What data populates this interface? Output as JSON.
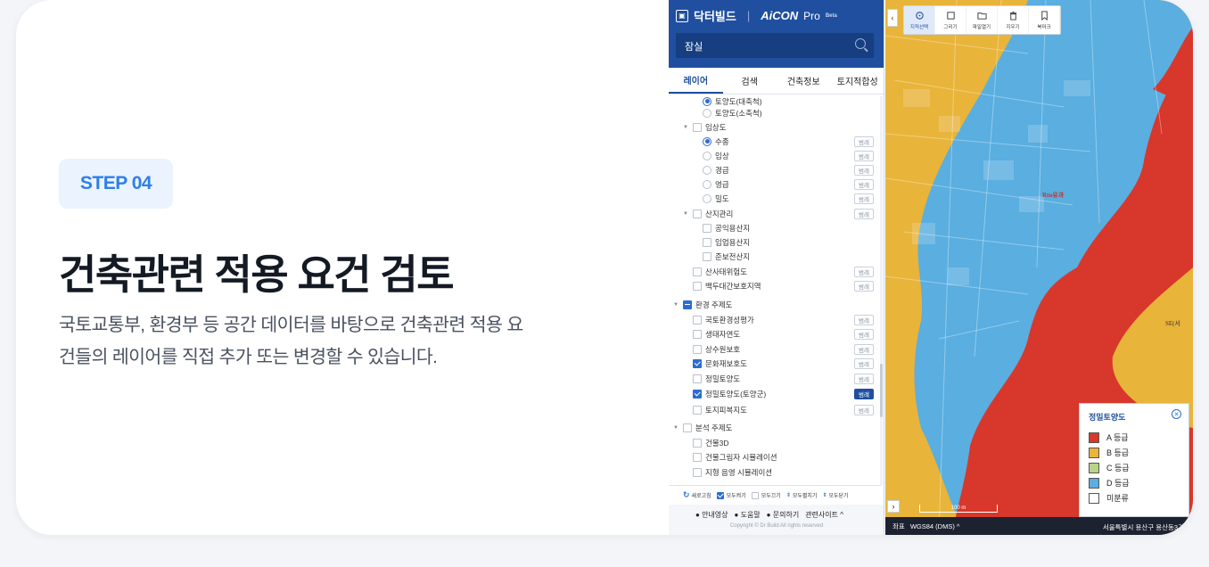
{
  "intro": {
    "step": "STEP 04",
    "headline": "건축관련 적용 요건 검토",
    "desc_line1": "국토교통부, 환경부 등 공간 데이터를 바탕으로 건축관련 적용 요",
    "desc_line2": "건들의 레이어를 직접 추가 또는 변경할 수 있습니다."
  },
  "app": {
    "brand": "닥터빌드",
    "brand2": "AiCON",
    "brand3": "Pro",
    "brand_beta": "Beta",
    "search_value": "잠실",
    "tabs": [
      "레이어",
      "검색",
      "건축정보",
      "토지적합성"
    ],
    "legend_label": "범례",
    "layers": [
      "토양도(대축척)",
      "토양도(소축척)",
      "임상도",
      "수종",
      "임상",
      "경급",
      "영급",
      "밀도",
      "산지관리",
      "공익용산지",
      "임업용산지",
      "준보전산지",
      "산사태위험도",
      "백두대간보호지역",
      "환경 주제도",
      "국토환경성평가",
      "생태자연도",
      "상수원보호",
      "문화재보호도",
      "정밀토양도",
      "정밀토양도(토양군)",
      "토지피복지도",
      "분석 주제도",
      "건물3D",
      "건물그림자 시뮬레이션",
      "지형 음영 시뮬레이션"
    ],
    "actions": [
      "새로고침",
      "모두켜기",
      "모두끄기",
      "모두펼치기",
      "모두닫기"
    ],
    "footer": [
      "안내영상",
      "도움말",
      "문의하기",
      "관련사이트 ^"
    ],
    "copyright": "Copyright © Dr Build All rights reserved"
  },
  "map": {
    "tools": [
      "지적선택",
      "그리기",
      "파일열기",
      "지우기",
      "북마크"
    ],
    "scale": "100 m",
    "coord_label": "좌표",
    "coord_system": "WGS84 (DMS) ^",
    "address": "서울특별시 용산구 용산동3가",
    "legend_title": "정밀토양도",
    "legend_items": [
      {
        "label": "A 등급",
        "color": "#d8372b"
      },
      {
        "label": "B 등급",
        "color": "#e8b43a"
      },
      {
        "label": "C 등급",
        "color": "#b8d48a"
      },
      {
        "label": "D 등급",
        "color": "#5aaee0"
      },
      {
        "label": "미분류",
        "color": "#ffffff"
      }
    ],
    "place_label_1": "Rtu유과",
    "place_label_2": "SE(서"
  }
}
